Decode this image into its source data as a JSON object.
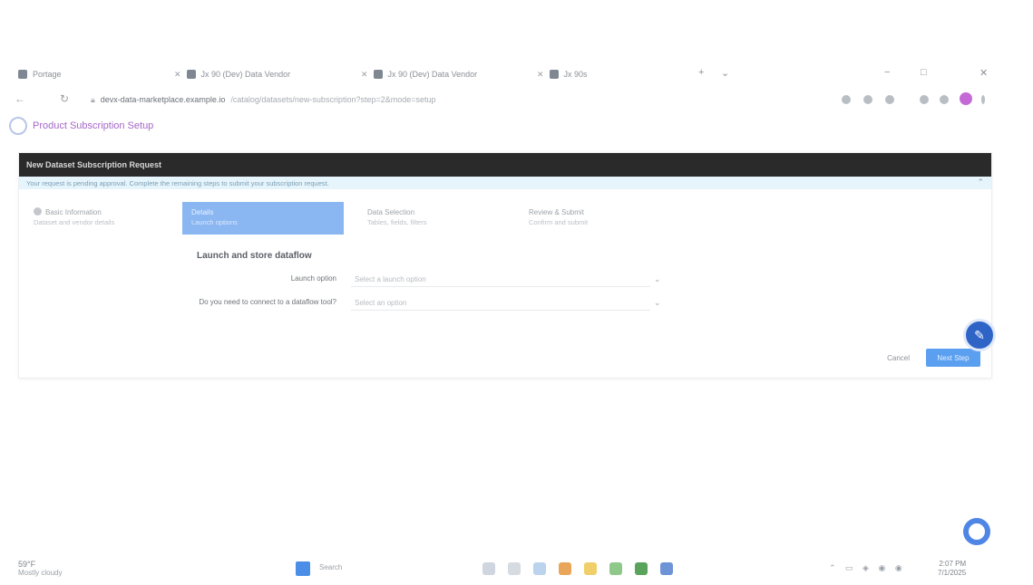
{
  "browser": {
    "tabs": [
      {
        "label": "Portage",
        "icon": "page-icon"
      },
      {
        "label": "Jx 90 (Dev) Data Vendor",
        "icon": "page-icon"
      },
      {
        "label": "Jx 90 (Dev) Data Vendor",
        "icon": "page-icon"
      },
      {
        "label": "Jx 90s",
        "icon": "page-icon"
      }
    ],
    "url_host": "devx-data-marketplace.example.io",
    "url_path": "/catalog/datasets/new-subscription?step=2&mode=setup",
    "window_controls": [
      "−",
      "□",
      "✕"
    ]
  },
  "page": {
    "title": "Product Subscription Setup",
    "panel_header": "New Dataset Subscription Request",
    "info_text": "Your request is pending approval. Complete the remaining steps to submit your subscription request.",
    "steps": [
      {
        "label": "Basic Information",
        "sub": "Dataset and vendor details"
      },
      {
        "label": "Details",
        "sub": "Launch options"
      },
      {
        "label": "Data Selection",
        "sub": "Tables, fields, filters"
      },
      {
        "label": "Review & Submit",
        "sub": "Confirm and submit"
      }
    ],
    "section_title": "Launch and store dataflow",
    "fields": [
      {
        "label": "Launch option",
        "placeholder": "Select a launch option"
      },
      {
        "label": "Do you need to connect to a dataflow tool?",
        "placeholder": "Select an option"
      }
    ],
    "cancel_label": "Cancel",
    "next_label": "Next Step"
  },
  "taskbar": {
    "weather_temp": "59°F",
    "weather_desc": "Mostly cloudy",
    "search_label": "Search",
    "time": "2:07 PM",
    "date": "7/1/2025"
  },
  "colors": {
    "accent": "#5a9ff0",
    "title_purple": "#a566c9",
    "header_dark": "#2a2a2a",
    "fab_blue": "#2f64c7"
  }
}
